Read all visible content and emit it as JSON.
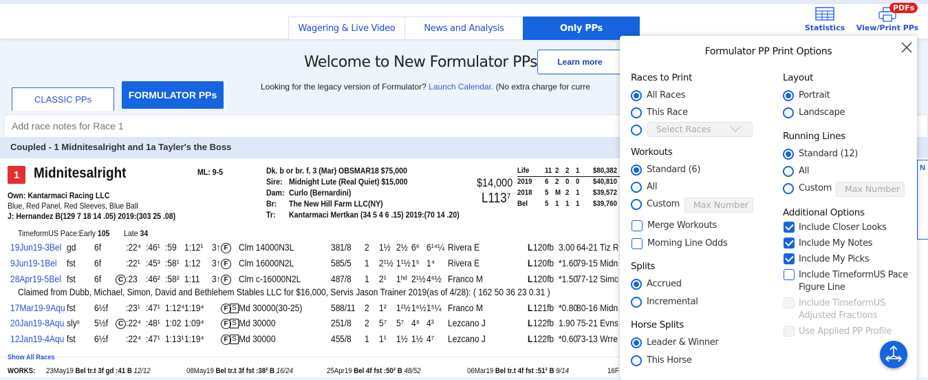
{
  "header": {
    "nav_tabs": [
      {
        "label": "Wagering & Live Video",
        "active": false
      },
      {
        "label": "News and Analysis",
        "active": false
      },
      {
        "label": "Only PPs",
        "active": true
      }
    ],
    "statistics_label": "Statistics",
    "view_print_label": "View/Print PPs",
    "pdfs_badge": "PDFs"
  },
  "banner": {
    "welcome": "Welcome to New Formulator PPs",
    "learn_more": "Learn more",
    "legacy_text": "Looking for the legacy version of Formulator?",
    "legacy_link": "Launch Calendar.",
    "legacy_tail": "(No extra charge for curre"
  },
  "pp_tabs": {
    "classic": "CLASSIC PPs",
    "formulator": "FORMULATOR PPs"
  },
  "notes_placeholder": "Add race notes for Race 1",
  "coupled": "Coupled - 1 Midnitesalright and 1a Tayler's the Boss",
  "horse": {
    "program_number": "1",
    "name": "Midnitesalright",
    "ml": "ML: 9-5",
    "owner": "Own: Kantarmaci Racing LLC",
    "silks": "Blue, Red Panel, Red Sleeves, Blue Ball",
    "jockey": "J: Hernandez B(129 7 18 14 .05) 2019:(303 25 .08)",
    "pace_label": "TimeformUS Pace:",
    "early_label": "Early",
    "early": "105",
    "late_label": "Late",
    "late": "34",
    "breeding": "Dk. b or br. f. 3 (Mar) OBSMAR18 $75,000",
    "sire_label": "Sire:",
    "sire": "Midnight Lute (Real Quiet) $15,000",
    "dam_label": "Dam:",
    "dam": "Curlo (Bernardini)",
    "br_label": "Br:",
    "breeder": "The New Hill Farm LLC(NY)",
    "tr_label": "Tr:",
    "trainer": "Kantarmaci Mertkan (34 5 4 6 .15) 2019:(70 14 .20)",
    "claim_price": "$14,000",
    "weight": "L113⁷",
    "records": [
      [
        "Life",
        "11",
        "2",
        "2",
        "1",
        "$80,382"
      ],
      [
        "2019",
        "6",
        "2",
        "0",
        "0",
        "$40,810"
      ],
      [
        "2018",
        "5",
        "M",
        "2",
        "1",
        "$39,572"
      ],
      [
        "Bel",
        "5",
        "1",
        "1",
        "1",
        "$39,760"
      ]
    ]
  },
  "past_performances": [
    {
      "date": "19Jun19-3Bel",
      "cond": "gd",
      "dist": "6f",
      "c": "",
      "f1": ":22⁴",
      "f2": ":46¹",
      "f3": ":59",
      "f4": "1:12¹",
      "age": "3↑",
      "sex": "F",
      "s": "",
      "race": "Clm 14000N3L",
      "fig": "38",
      "pp": "1/8",
      "st": "2",
      "c1": "1½",
      "c2": "2½",
      "c3": "6⁶",
      "fin": "6¹⁴¼",
      "jockey": "Rivera E",
      "wt": "120fb",
      "odds": " 3.00",
      "tail": "64-21 Tiz R"
    },
    {
      "date": "9Jun19-1Bel",
      "cond": "fst",
      "dist": "6f",
      "c": "",
      "f1": ":22¹",
      "f2": ":45³",
      "f3": ":58¹",
      "f4": "1:12",
      "age": "3↑",
      "sex": "F",
      "s": "",
      "race": "Clm 16000N2L",
      "fig": "58",
      "pp": "5/5",
      "st": "1",
      "c1": "2¹½",
      "c2": "1¹½",
      "c3": "1⁵",
      "fin": "1⁴",
      "jockey": "Rivera E",
      "wt": "120fb",
      "odds": "*1.60",
      "tail": "79-15 Midn"
    },
    {
      "date": "28Apr19-5Bel",
      "cond": "fst",
      "dist": "6f",
      "c": "C",
      "f1": ":23",
      "f2": ":46²",
      "f3": ":58²",
      "f4": "1:11",
      "age": "3↑",
      "sex": "F",
      "s": "",
      "race": "Clm c-16000N2L",
      "fig": "48",
      "pp": "7/8",
      "st": "1",
      "c1": "2¹",
      "c2": "1ʰᵈ",
      "c3": "2¹½",
      "fin": "4⁶½",
      "jockey": "Franco M",
      "wt": "120fb",
      "odds": "*1.50",
      "tail": "77-12 Simo"
    },
    {
      "claim": "Claimed from Dubb, Michael, Simon, David and Bethlehem Stables LLC for $16,000, Servis Jason Trainer 2019(as of 4/28): ( 162 50 36 23 0.31 )"
    },
    {
      "date": "17Mar19-9Aqu",
      "cond": "fst",
      "dist": "6½f",
      "c": "",
      "f1": ":23¹",
      "f2": ":47¹",
      "f3": "1:12⁴",
      "f4": "1:19⁴",
      "age": "",
      "sex": "F",
      "s": "S",
      "race": "Md 30000(30-25)",
      "fig": "58",
      "pp": "8/11",
      "st": "2",
      "c1": "1²",
      "c2": "1²½",
      "c3": "1⁶½",
      "fin": "1⁵¼",
      "jockey": "Franco M",
      "wt": "121fb",
      "odds": "*0.80",
      "tail": "80-16 Midn"
    },
    {
      "date": "20Jan19-8Aqu",
      "cond": "slyˢ",
      "dist": "5½f",
      "c": "C",
      "f1": ":22⁴",
      "f2": ":48¹",
      "f3": "1:02",
      "f4": "1:09⁴",
      "age": "",
      "sex": "F",
      "s": "S",
      "race": "Md 30000",
      "fig": "25",
      "pp": "1/8",
      "st": "2",
      "c1": "5⁷",
      "c2": "5⁷",
      "c3": "4⁸",
      "fin": "4³",
      "jockey": "Lezcano J",
      "wt": "122fb",
      "odds": " 1.90",
      "tail": "75-21 Evns"
    },
    {
      "date": "12Jan19-4Aqu",
      "cond": "fst",
      "dist": "6½f",
      "c": "",
      "f1": ":22⁴",
      "f2": ":47¹",
      "f3": "1:13¹",
      "f4": "1:19⁴",
      "age": "",
      "sex": "F",
      "s": "S",
      "race": "Md 30000",
      "fig": "45",
      "pp": "5/8",
      "st": "1",
      "c1": "1¹",
      "c2": "1½",
      "c3": "1½",
      "fin": "4⁷",
      "jockey": "Lezcano J",
      "wt": "122fb",
      "odds": "*0.60",
      "tail": "73-13 Wrre"
    }
  ],
  "show_all_races": "Show All Races",
  "works": {
    "label": "WORKS:",
    "items": [
      {
        "date": "23May19",
        "info": "Bel tr.t 3f gd :41 B",
        "rank": "12/12"
      },
      {
        "date": "08May19",
        "info": "Bel tr.t 3f fst :38² B",
        "rank": "16/24"
      },
      {
        "date": "25Apr19",
        "info": "Bel 4f fst :50² B",
        "rank": "48/52"
      },
      {
        "date": "06Mar19",
        "info": "Bel tr.t 4f fst :51² B",
        "rank": "9/14"
      },
      {
        "date": "16F",
        "info": "",
        "rank": ""
      }
    ]
  },
  "dialog": {
    "title": "Formulator PP Print Options",
    "races_to_print": {
      "heading": "Races to Print",
      "options": [
        {
          "label": "All Races",
          "selected": true
        },
        {
          "label": "This Race",
          "selected": false
        },
        {
          "label": "",
          "selected": false
        }
      ],
      "select_placeholder": "Select Races"
    },
    "workouts": {
      "heading": "Workouts",
      "options": [
        {
          "label": "Standard (6)",
          "selected": true
        },
        {
          "label": "All",
          "selected": false
        },
        {
          "label": "Custom",
          "selected": false
        }
      ],
      "max_placeholder": "Max Number"
    },
    "workout_checks": [
      {
        "label": "Merge Workouts",
        "checked": false
      },
      {
        "label": "Morning Line Odds",
        "checked": false
      }
    ],
    "splits": {
      "heading": "Splits",
      "options": [
        {
          "label": "Accrued",
          "selected": true
        },
        {
          "label": "Incremental",
          "selected": false
        }
      ]
    },
    "horse_splits": {
      "heading": "Horse Splits",
      "options": [
        {
          "label": "Leader & Winner",
          "selected": true
        },
        {
          "label": "This Horse",
          "selected": false
        }
      ]
    },
    "layout": {
      "heading": "Layout",
      "options": [
        {
          "label": "Portrait",
          "selected": true
        },
        {
          "label": "Landscape",
          "selected": false
        }
      ]
    },
    "running_lines": {
      "heading": "Running Lines",
      "options": [
        {
          "label": "Standard (12)",
          "selected": true
        },
        {
          "label": "All",
          "selected": false
        },
        {
          "label": "Custom",
          "selected": false
        }
      ],
      "max_placeholder": "Max Number"
    },
    "additional": {
      "heading": "Additional Options",
      "options": [
        {
          "label": "Include Closer Looks",
          "checked": true,
          "disabled": false
        },
        {
          "label": "Include My Notes",
          "checked": true,
          "disabled": false
        },
        {
          "label": "Include My Picks",
          "checked": true,
          "disabled": false
        },
        {
          "label": "Include TimeformUS Pace Figure Line",
          "checked": false,
          "disabled": false
        },
        {
          "label": "Include TimeformUS Adjusted Fractions",
          "checked": false,
          "disabled": true
        },
        {
          "label": "Use Applied PP Profile",
          "checked": false,
          "disabled": true
        }
      ]
    }
  },
  "colors": {
    "accent": "#1565e0",
    "badge": "#e81c1c",
    "link": "#2b4fd8",
    "program_number": "#e03030"
  }
}
